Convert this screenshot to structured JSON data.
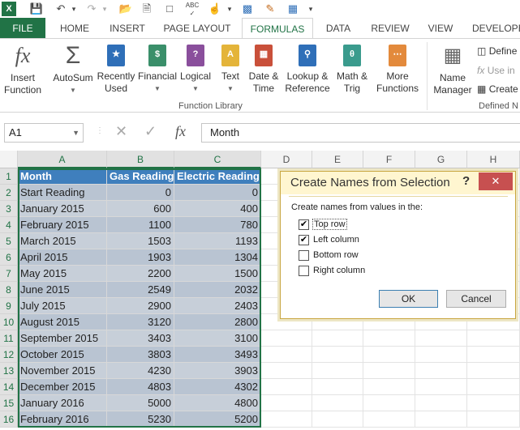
{
  "quick_access": {
    "icons": [
      "excel-logo-icon",
      "save-icon",
      "undo-icon",
      "redo-icon",
      "open-icon",
      "new-icon",
      "blank-doc-icon",
      "spelling-icon",
      "touch-mode-icon",
      "chart-icon",
      "paint-icon",
      "grid-icon"
    ]
  },
  "tabs": [
    "FILE",
    "HOME",
    "INSERT",
    "PAGE LAYOUT",
    "FORMULAS",
    "DATA",
    "REVIEW",
    "VIEW",
    "DEVELOPER"
  ],
  "ribbon": {
    "insert_function": "Insert\nFunction",
    "autosum": "AutoSum",
    "recently_used": "Recently\nUsed",
    "financial": "Financial",
    "logical": "Logical",
    "text": "Text",
    "date_time": "Date &\nTime",
    "lookup": "Lookup &\nReference",
    "math": "Math &\nTrig",
    "more": "More\nFunctions",
    "group_label": "Function Library",
    "name_manager": "Name\nManager",
    "define": "Define",
    "use_in": "Use in",
    "create": "Create",
    "defined_names": "Defined N"
  },
  "formula_bar": {
    "name_box": "A1",
    "formula": "Month"
  },
  "columns": [
    "A",
    "B",
    "C",
    "D",
    "E",
    "F",
    "G",
    "H"
  ],
  "rows": [
    {
      "n": "1",
      "a": "Month",
      "b": "Gas Reading",
      "c": "Electric Reading"
    },
    {
      "n": "2",
      "a": "Start Reading",
      "b": "0",
      "c": "0"
    },
    {
      "n": "3",
      "a": "January 2015",
      "b": "600",
      "c": "400"
    },
    {
      "n": "4",
      "a": "February 2015",
      "b": "1100",
      "c": "780"
    },
    {
      "n": "5",
      "a": "March 2015",
      "b": "1503",
      "c": "1193"
    },
    {
      "n": "6",
      "a": "April 2015",
      "b": "1903",
      "c": "1304"
    },
    {
      "n": "7",
      "a": "May 2015",
      "b": "2200",
      "c": "1500"
    },
    {
      "n": "8",
      "a": "June 2015",
      "b": "2549",
      "c": "2032"
    },
    {
      "n": "9",
      "a": "July 2015",
      "b": "2900",
      "c": "2403"
    },
    {
      "n": "10",
      "a": "August 2015",
      "b": "3120",
      "c": "2800"
    },
    {
      "n": "11",
      "a": "September 2015",
      "b": "3403",
      "c": "3100"
    },
    {
      "n": "12",
      "a": "October 2015",
      "b": "3803",
      "c": "3493"
    },
    {
      "n": "13",
      "a": "November 2015",
      "b": "4230",
      "c": "3903"
    },
    {
      "n": "14",
      "a": "December 2015",
      "b": "4803",
      "c": "4302"
    },
    {
      "n": "15",
      "a": "January 2016",
      "b": "5000",
      "c": "4800"
    },
    {
      "n": "16",
      "a": "February 2016",
      "b": "5230",
      "c": "5200"
    }
  ],
  "dialog": {
    "title": "Create Names from Selection",
    "help": "?",
    "close": "✕",
    "prompt": "Create names from values in the:",
    "options": [
      {
        "label": "Top row",
        "checked": true
      },
      {
        "label": "Left column",
        "checked": true
      },
      {
        "label": "Bottom row",
        "checked": false
      },
      {
        "label": "Right column",
        "checked": false
      }
    ],
    "ok": "OK",
    "cancel": "Cancel"
  },
  "colors": {
    "accent": "#217346",
    "header_fill": "#3f7fbd",
    "dialog_close": "#c75050"
  }
}
